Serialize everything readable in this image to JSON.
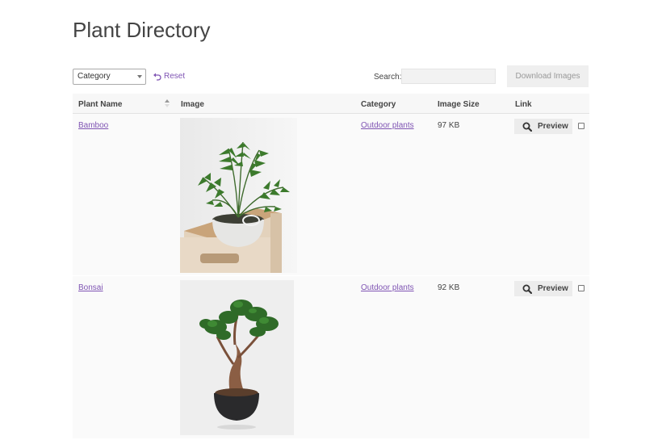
{
  "page": {
    "title": "Plant Directory"
  },
  "toolbar": {
    "category_select": "Category",
    "reset_label": "Reset",
    "search_label": "Search:",
    "search_value": "",
    "download_label": "Download Images"
  },
  "table": {
    "headers": {
      "name": "Plant Name",
      "image": "Image",
      "category": "Category",
      "size": "Image Size",
      "link": "Link"
    },
    "rows": [
      {
        "name": "Bamboo",
        "category": "Outdoor plants",
        "size": "97 KB",
        "preview_label": "Preview",
        "image_icon": "bamboo-palm-photo"
      },
      {
        "name": "Bonsai",
        "category": "Outdoor plants",
        "size": "92 KB",
        "preview_label": "Preview",
        "image_icon": "bonsai-tree-photo"
      }
    ]
  },
  "colors": {
    "accent": "#7f54b3",
    "row_bg": "#fafafa",
    "header_bg": "#f7f7f7"
  }
}
